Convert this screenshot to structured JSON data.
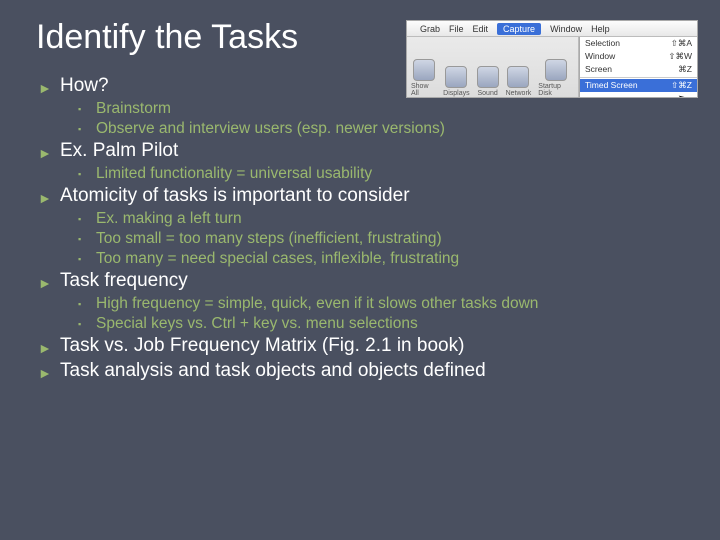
{
  "title": "Identify the Tasks",
  "bullets": {
    "b1": "How?",
    "b1s": {
      "a": "Brainstorm",
      "b": "Observe and interview users (esp. newer versions)"
    },
    "b2": "Ex. Palm Pilot",
    "b2s": {
      "a": "Limited functionality = universal usability"
    },
    "b3": "Atomicity of tasks is important to consider",
    "b3s": {
      "a": "Ex. making a left turn",
      "b": "Too small = too many steps (inefficient, frustrating)",
      "c": "Too many = need special cases, inflexible, frustrating"
    },
    "b4": "Task frequency",
    "b4s": {
      "a": "High frequency = simple, quick, even if it slows other tasks down",
      "b": "Special keys vs. Ctrl + key vs. menu selections"
    },
    "b5": "Task vs. Job Frequency Matrix (Fig. 2.1 in book)",
    "b6": "Task analysis and task objects and objects defined"
  },
  "macshot": {
    "menubar": {
      "apple": "",
      "grab": "Grab",
      "file": "File",
      "edit": "Edit",
      "capture": "Capture",
      "window": "Window",
      "help": "Help"
    },
    "dropdown": {
      "selection": {
        "label": "Selection",
        "key": "⇧⌘A"
      },
      "window": {
        "label": "Window",
        "key": "⇧⌘W"
      },
      "screen": {
        "label": "Screen",
        "key": "⌘Z"
      },
      "timed": {
        "label": "Timed Screen",
        "key": "⇧⌘Z"
      }
    },
    "toolbar": {
      "a": "Show All",
      "b": "Displays",
      "c": "Sound",
      "d": "Network",
      "e": "Startup Disk"
    }
  }
}
